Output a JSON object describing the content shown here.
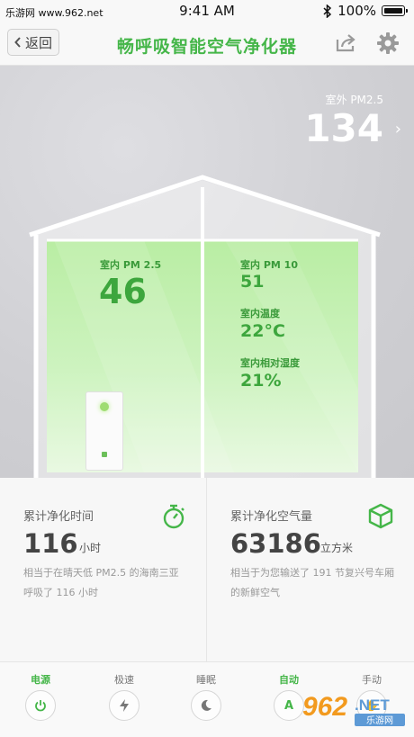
{
  "status_bar": {
    "site": "乐游网 www.962.net",
    "time": "9:41 AM",
    "battery": "100%"
  },
  "nav": {
    "back_label": "返回",
    "title": "畅呼吸智能空气净化器"
  },
  "outdoor": {
    "label": "室外 PM2.5",
    "value": "134"
  },
  "indoor": {
    "pm25_label": "室内 PM 2.5",
    "pm25_value": "46",
    "pm10_label": "室内 PM 10",
    "pm10_value": "51",
    "temp_label": "室内温度",
    "temp_value": "22°C",
    "humidity_label": "室内相对湿度",
    "humidity_value": "21%"
  },
  "stats": {
    "time": {
      "label": "累计净化时间",
      "value": "116",
      "unit": "小时",
      "desc": "相当于在晴天低 PM2.5 的海南三亚呼吸了 116 小时"
    },
    "air": {
      "label": "累计净化空气量",
      "value": "63186",
      "unit": "立方米",
      "desc": "相当于为您输送了 191 节复兴号车厢的新鲜空气"
    }
  },
  "modes": [
    {
      "label": "电源",
      "icon": "power-icon",
      "active": true
    },
    {
      "label": "极速",
      "icon": "lightning-icon",
      "active": false
    },
    {
      "label": "睡眠",
      "icon": "moon-icon",
      "active": false
    },
    {
      "label": "自动",
      "icon": "auto-icon",
      "active": true
    },
    {
      "label": "手动",
      "icon": "hand-icon",
      "active": false
    }
  ],
  "watermark": "962.NET 乐游网",
  "colors": {
    "accent": "#45b649",
    "hero_bg": "#d2d2d6",
    "indoor_glow": "#c9f0b8"
  }
}
